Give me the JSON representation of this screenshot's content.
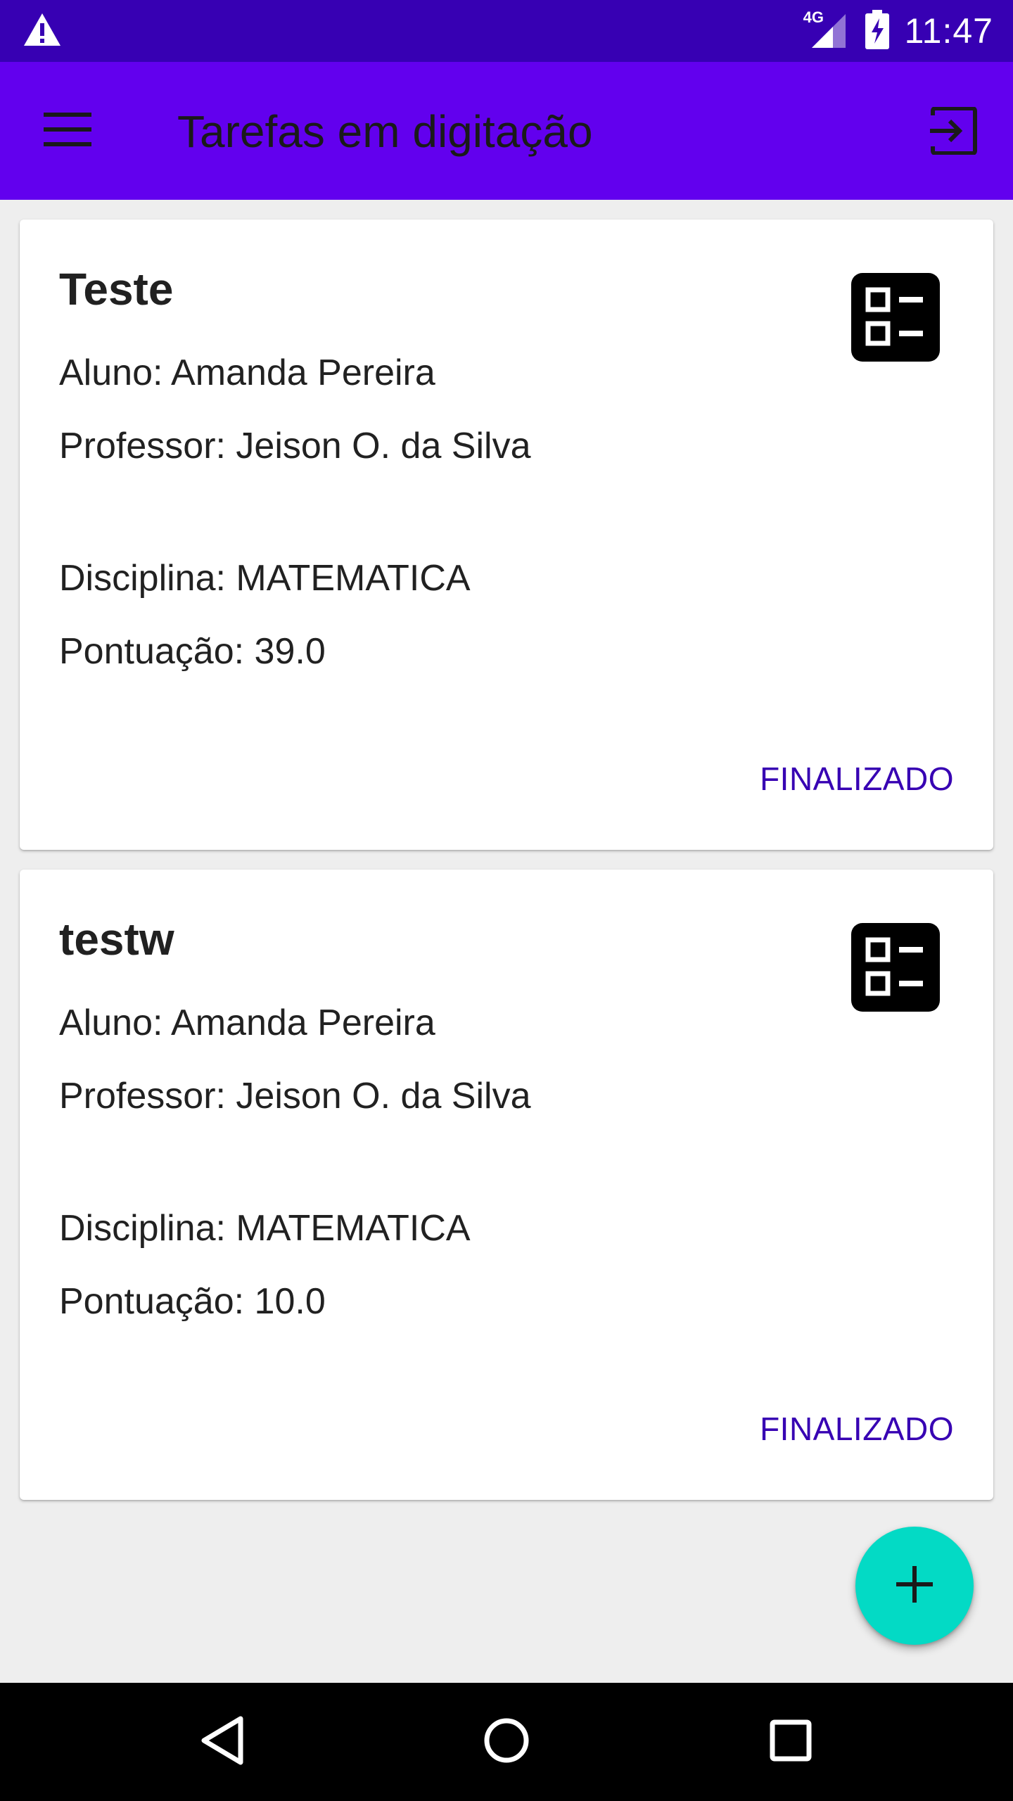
{
  "status_bar": {
    "network": "4G",
    "time": "11:47"
  },
  "app_bar": {
    "title": "Tarefas em digitação",
    "menu_icon": "menu-icon",
    "logout_icon": "logout-icon"
  },
  "tasks": [
    {
      "title": "Teste",
      "aluno": "Aluno: Amanda Pereira",
      "professor": "Professor: Jeison O. da Silva",
      "disciplina": "Disciplina: MATEMATICA",
      "pontuacao": "Pontuação: 39.0",
      "action": "FINALIZADO"
    },
    {
      "title": "testw",
      "aluno": "Aluno: Amanda Pereira",
      "professor": "Professor: Jeison O. da Silva",
      "disciplina": "Disciplina: MATEMATICA",
      "pontuacao": "Pontuação: 10.0",
      "action": "FINALIZADO"
    }
  ],
  "fab": {
    "icon": "plus-icon"
  },
  "colors": {
    "status_bar": "#3700B3",
    "app_bar": "#6200EE",
    "accent": "#03DAC5",
    "action_text": "#3700B3"
  }
}
